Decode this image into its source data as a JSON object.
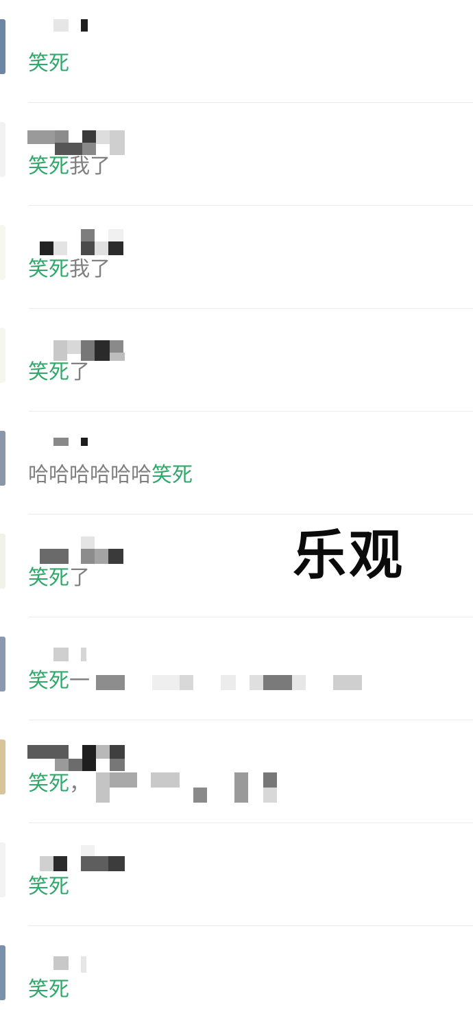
{
  "comments": [
    {
      "avatar_color": "#6d86a3",
      "segments": [
        {
          "text": "笑死",
          "highlight": true
        }
      ]
    },
    {
      "avatar_color": "#f2f2f2",
      "segments": [
        {
          "text": "笑死",
          "highlight": true
        },
        {
          "text": "我了",
          "highlight": false
        }
      ]
    },
    {
      "avatar_color": "#f6f7ef",
      "segments": [
        {
          "text": "笑死",
          "highlight": true
        },
        {
          "text": "我了",
          "highlight": false
        }
      ]
    },
    {
      "avatar_color": "#f5f6ee",
      "segments": [
        {
          "text": "笑死",
          "highlight": true
        },
        {
          "text": "了",
          "highlight": false
        }
      ]
    },
    {
      "avatar_color": "#8b97a8",
      "segments": [
        {
          "text": "哈哈哈哈哈哈",
          "highlight": false
        },
        {
          "text": "笑死",
          "highlight": true
        }
      ]
    },
    {
      "avatar_color": "#f1f3e8",
      "segments": [
        {
          "text": "笑死",
          "highlight": true
        },
        {
          "text": "了",
          "highlight": false
        }
      ]
    },
    {
      "avatar_color": "#8a98b0",
      "segments": [
        {
          "text": "笑死",
          "highlight": true
        },
        {
          "text": "一",
          "highlight": false
        }
      ]
    },
    {
      "avatar_color": "#d9c49a",
      "segments": [
        {
          "text": "笑死",
          "highlight": true
        },
        {
          "text": "，",
          "highlight": false
        }
      ]
    },
    {
      "avatar_color": "#f3f3f3",
      "segments": [
        {
          "text": "笑死",
          "highlight": true
        }
      ]
    },
    {
      "avatar_color": "#7b90ab",
      "segments": [
        {
          "text": "笑死",
          "highlight": true
        }
      ]
    }
  ],
  "overlay_caption": "乐观",
  "colors": {
    "highlight": "#2fa86a",
    "body_text": "#808080",
    "divider": "#ebebeb"
  }
}
